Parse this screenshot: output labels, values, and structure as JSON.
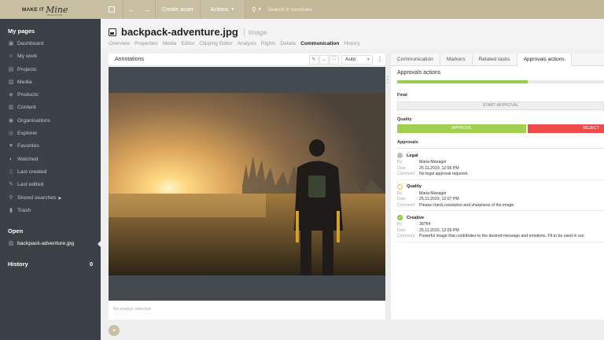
{
  "brand": {
    "line1": "MAKE IT",
    "line2": "Mine",
    "line3": "MAGAZINE"
  },
  "colors": {
    "accent": "#c9c0a3",
    "sidebar_bg": "#3b4146",
    "approve": "#a1cf4f",
    "reject": "#ef4b4b"
  },
  "topbar": {
    "toggle_icon": "square-icon",
    "back_icon": "arrow-left-icon",
    "forward_icon": "arrow-right-icon",
    "create_asset": "Create asset",
    "actions": "Actions",
    "search_placeholder": "Search in censhare"
  },
  "sidebar": {
    "my_pages": "My pages",
    "items": [
      {
        "label": "Dashboard",
        "icon": "dashboard-icon"
      },
      {
        "label": "My work",
        "icon": "user-icon"
      },
      {
        "label": "Projects",
        "icon": "folder-icon"
      },
      {
        "label": "Media",
        "icon": "image-icon"
      },
      {
        "label": "Products",
        "icon": "box-icon"
      },
      {
        "label": "Content",
        "icon": "document-icon"
      },
      {
        "label": "Organisations",
        "icon": "globe-icon"
      },
      {
        "label": "Explorer",
        "icon": "compass-icon"
      },
      {
        "label": "Favorites",
        "icon": "heart-icon"
      },
      {
        "label": "Watched",
        "icon": "eye-icon"
      },
      {
        "label": "Last created",
        "icon": "file-icon"
      },
      {
        "label": "Last edited",
        "icon": "edit-icon"
      },
      {
        "label": "Stored searches",
        "icon": "search-icon"
      },
      {
        "label": "Trash",
        "icon": "trash-icon"
      }
    ],
    "open": "Open",
    "open_item": "backpack-adventure.jpg",
    "history": "History",
    "history_count": "0"
  },
  "header": {
    "title": "backpack-adventure.jpg",
    "type": "Image",
    "tabs": [
      "Overview",
      "Properties",
      "Media",
      "Editor",
      "Clipping Editor",
      "Analysis",
      "Rights",
      "Details",
      "Communication",
      "History"
    ],
    "active_tab": "Communication"
  },
  "annotations": {
    "title": "Annotations",
    "zoom": "Auto",
    "footer": "No marker selected"
  },
  "right": {
    "tabs": [
      "Communication",
      "Markers",
      "Related tasks",
      "Approvals actions"
    ],
    "heading": "Approvals actions",
    "progress": 0.63,
    "final_label": "Final",
    "start_approval": "START APPROVAL",
    "quality_label": "Quality",
    "approve": "APPROVE",
    "reject": "REJECT",
    "approvals_label": "Approvals",
    "labels": {
      "by": "By",
      "date": "Date",
      "comment": "Comment"
    },
    "approvals": [
      {
        "name": "Legal",
        "by": "Maria Manager",
        "date": "25.11.2019, 12:06 PM",
        "comment": "No legal approval required."
      },
      {
        "name": "Quality",
        "by": "Maria Manager",
        "date": "25.11.2019, 12:07 PM",
        "comment": "Please check resolution and sharpness of the image."
      },
      {
        "name": "Creative",
        "by": "38754",
        "date": "25.11.2019, 12:09 PM",
        "comment": "Powerful image that contributes to the desired message and emotions. Fit to be used in our"
      }
    ]
  }
}
